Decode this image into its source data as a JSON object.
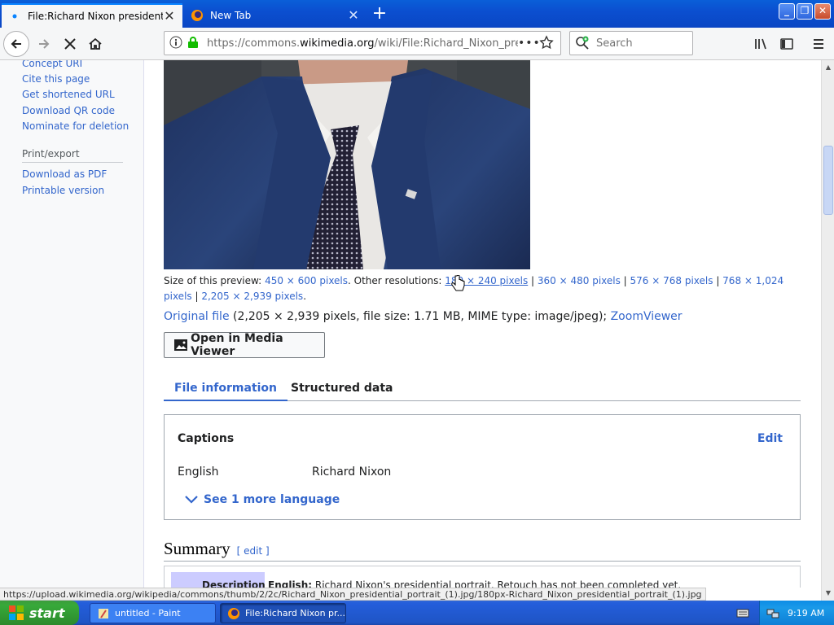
{
  "browser": {
    "tabs": [
      {
        "title": "File:Richard Nixon presidential por",
        "active": true
      },
      {
        "title": "New Tab",
        "active": false
      }
    ],
    "url": {
      "prefix": "https://commons.",
      "domain": "wikimedia.org",
      "path": "/wiki/File:Richard_Nixon_pre"
    },
    "search_placeholder": "Search",
    "status_url": "https://upload.wikimedia.org/wikipedia/commons/thumb/2/2c/Richard_Nixon_presidential_portrait_(1).jpg/180px-Richard_Nixon_presidential_portrait_(1).jpg"
  },
  "sidebar": {
    "tools": [
      "Concept URI",
      "Cite this page",
      "Get shortened URL",
      "Download QR code",
      "Nominate for deletion"
    ],
    "print_heading": "Print/export",
    "print_links": [
      "Download as PDF",
      "Printable version"
    ]
  },
  "file": {
    "size_label": "Size of this preview:",
    "preview_size": "450 × 600 pixels",
    "other_label": ". Other resolutions:",
    "resolutions": [
      "180 × 240 pixels",
      "360 × 480 pixels",
      "576 × 768 pixels",
      "768 × 1,024 pixels",
      "2,205 × 2,939 pixels"
    ],
    "original_link": "Original file",
    "original_info": " (2,205 × 2,939 pixels, file size: 1.71 MB, MIME type: image/jpeg); ",
    "zoomviewer": "ZoomViewer",
    "open_media_viewer": "Open in Media Viewer"
  },
  "file_tabs": [
    "File information",
    "Structured data"
  ],
  "captions": {
    "title": "Captions",
    "edit": "Edit",
    "language": "English",
    "value": "Richard Nixon",
    "more": "See 1 more language"
  },
  "summary": {
    "heading": "Summary",
    "edit": "[ edit ]",
    "desc_label": "Description",
    "desc_lang": "English:",
    "desc_text": " Richard Nixon's presidential portrait. Retouch has not been completed yet."
  },
  "taskbar": {
    "start": "start",
    "tasks": [
      "untitled - Paint",
      "File:Richard Nixon pr..."
    ],
    "clock": "9:19 AM"
  }
}
